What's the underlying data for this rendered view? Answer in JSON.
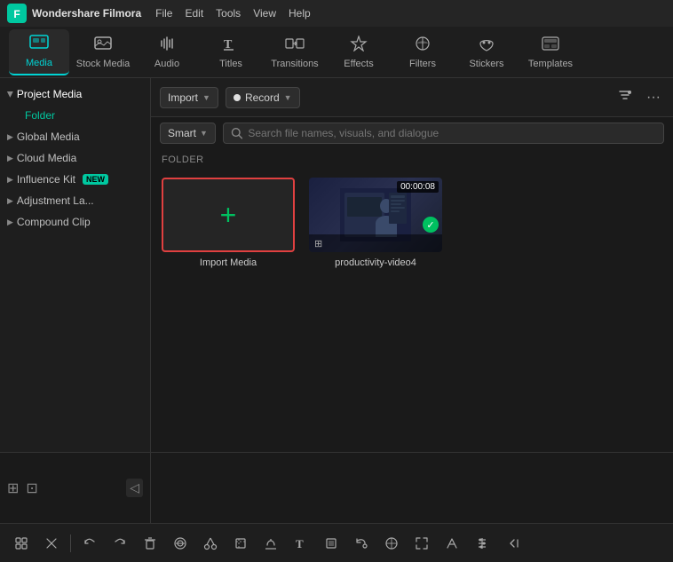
{
  "app": {
    "name": "Wondershare Filmora",
    "logo_char": "🎬"
  },
  "menu": {
    "items": [
      "File",
      "Edit",
      "Tools",
      "View",
      "Help"
    ]
  },
  "toolbar": {
    "items": [
      {
        "id": "media",
        "label": "Media",
        "icon": "▦",
        "active": true
      },
      {
        "id": "stock",
        "label": "Stock Media",
        "icon": "🖼"
      },
      {
        "id": "audio",
        "label": "Audio",
        "icon": "♪"
      },
      {
        "id": "titles",
        "label": "Titles",
        "icon": "T"
      },
      {
        "id": "transitions",
        "label": "Transitions",
        "icon": "↔"
      },
      {
        "id": "effects",
        "label": "Effects",
        "icon": "✦"
      },
      {
        "id": "filters",
        "label": "Filters",
        "icon": "◈"
      },
      {
        "id": "stickers",
        "label": "Stickers",
        "icon": "◎"
      },
      {
        "id": "templates",
        "label": "Templates",
        "icon": "▭"
      }
    ]
  },
  "sidebar": {
    "sections": [
      {
        "id": "project-media",
        "label": "Project Media",
        "expanded": true
      },
      {
        "id": "folder",
        "label": "Folder",
        "sub": true
      },
      {
        "id": "global-media",
        "label": "Global Media",
        "expanded": false
      },
      {
        "id": "cloud-media",
        "label": "Cloud Media",
        "expanded": false
      },
      {
        "id": "influence-kit",
        "label": "Influence Kit",
        "expanded": false,
        "badge": "NEW"
      },
      {
        "id": "adjustment-la",
        "label": "Adjustment La...",
        "expanded": false
      },
      {
        "id": "compound-clip",
        "label": "Compound Clip",
        "expanded": false
      }
    ]
  },
  "content_toolbar": {
    "import_label": "Import",
    "record_label": "Record",
    "filter_icon": "⊿",
    "more_icon": "···"
  },
  "search": {
    "smart_label": "Smart",
    "placeholder": "Search file names, visuals, and dialogue"
  },
  "folder_label": "FOLDER",
  "media_items": [
    {
      "id": "import-media",
      "type": "import",
      "label": "Import Media"
    },
    {
      "id": "productivity-video4",
      "type": "video",
      "label": "productivity-video4",
      "timestamp": "00:00:08"
    }
  ],
  "bottom_toolbar": {
    "icons": [
      "⊞",
      "⊡",
      "↩",
      "↪",
      "🗑",
      "⊕",
      "✂",
      "⊡",
      "♪",
      "T",
      "▭",
      "↺",
      "☉",
      "⊞",
      "↔",
      "⊕",
      "≡",
      "◁"
    ]
  }
}
